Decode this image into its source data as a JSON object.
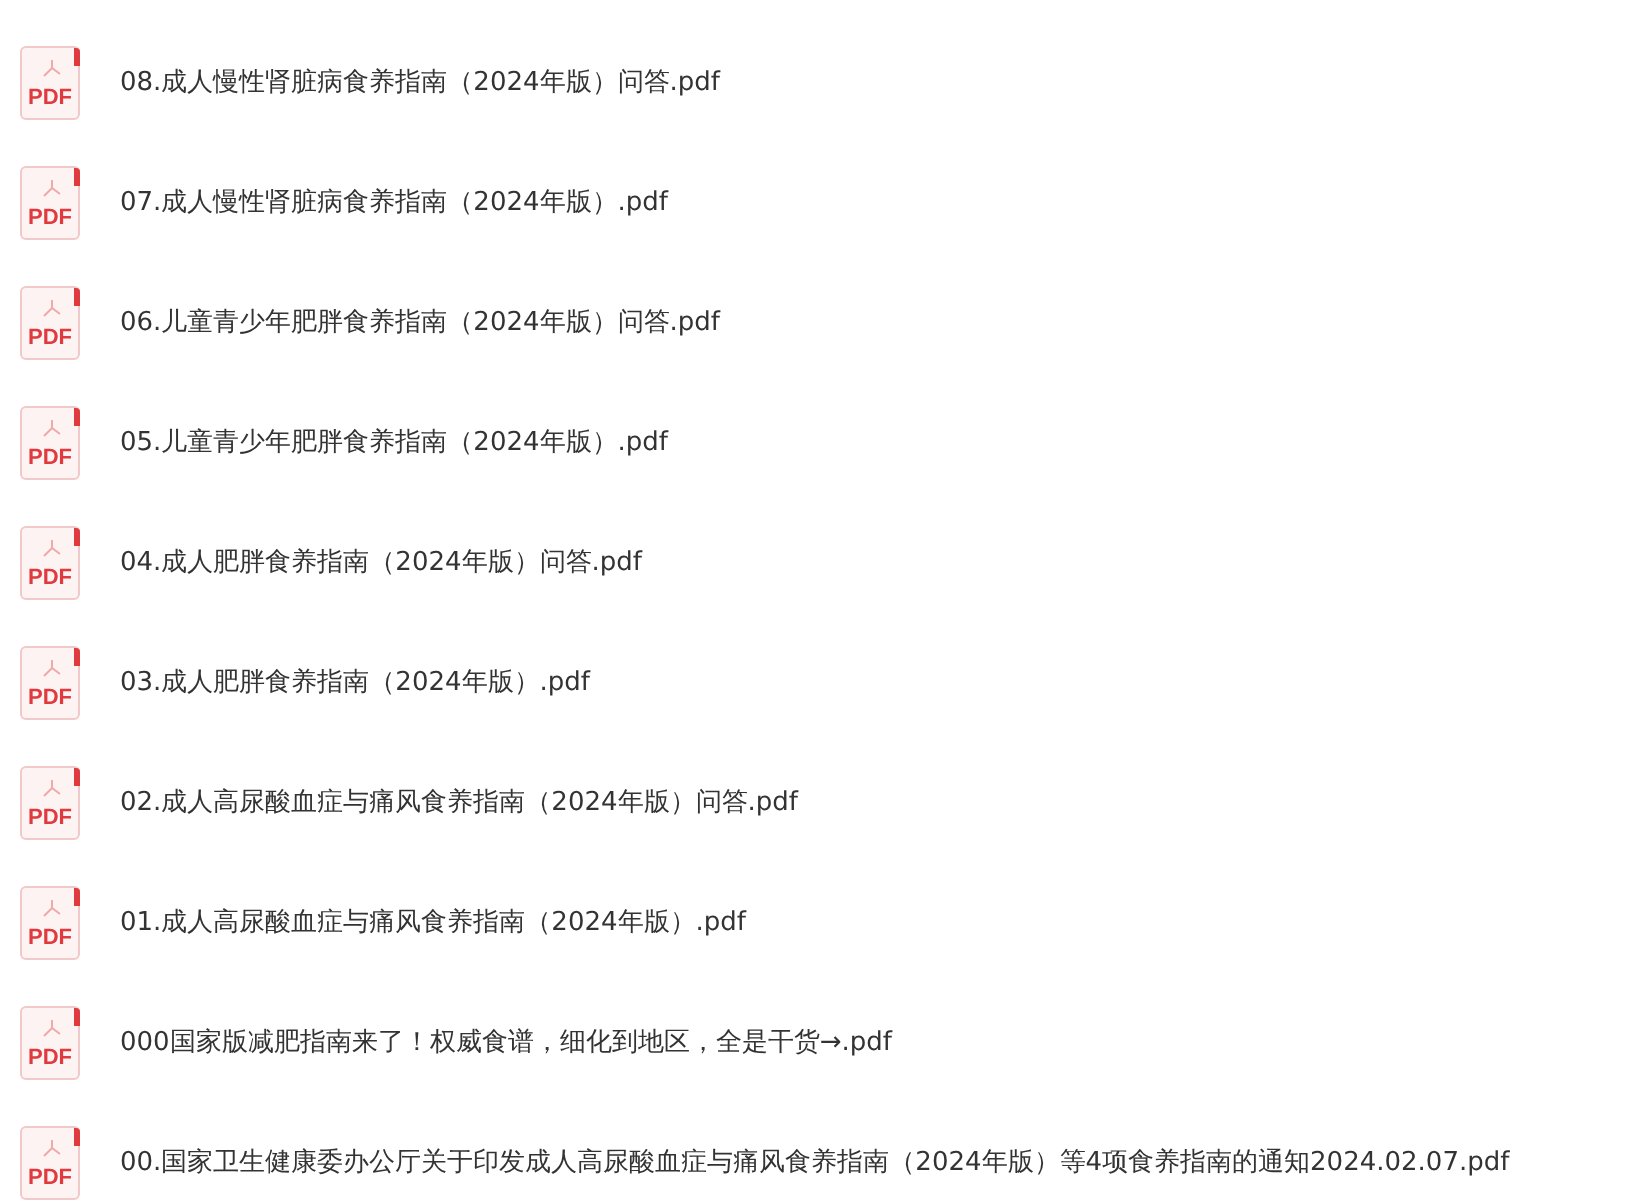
{
  "files": [
    {
      "name": "08.成人慢性肾脏病食养指南（2024年版）问答.pdf",
      "icon_label": "PDF"
    },
    {
      "name": "07.成人慢性肾脏病食养指南（2024年版）.pdf",
      "icon_label": "PDF"
    },
    {
      "name": "06.儿童青少年肥胖食养指南（2024年版）问答.pdf",
      "icon_label": "PDF"
    },
    {
      "name": "05.儿童青少年肥胖食养指南（2024年版）.pdf",
      "icon_label": "PDF"
    },
    {
      "name": "04.成人肥胖食养指南（2024年版）问答.pdf",
      "icon_label": "PDF"
    },
    {
      "name": "03.成人肥胖食养指南（2024年版）.pdf",
      "icon_label": "PDF"
    },
    {
      "name": "02.成人高尿酸血症与痛风食养指南（2024年版）问答.pdf",
      "icon_label": "PDF"
    },
    {
      "name": "01.成人高尿酸血症与痛风食养指南（2024年版）.pdf",
      "icon_label": "PDF"
    },
    {
      "name": "000国家版减肥指南来了！权威食谱，细化到地区，全是干货→.pdf",
      "icon_label": "PDF"
    },
    {
      "name": "00.国家卫生健康委办公厅关于印发成人高尿酸血症与痛风食养指南（2024年版）等4项食养指南的通知2024.02.07.pdf",
      "icon_label": "PDF"
    }
  ]
}
